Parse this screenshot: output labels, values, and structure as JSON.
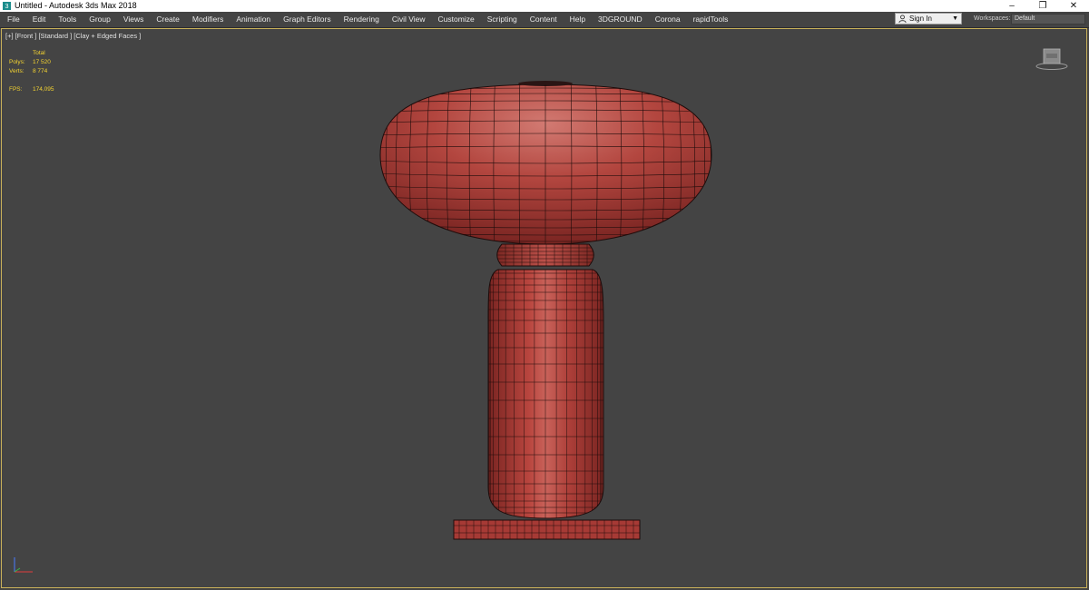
{
  "window": {
    "title": "Untitled - Autodesk 3ds Max 2018",
    "controls": [
      "–",
      "❐",
      "✕"
    ]
  },
  "menu": [
    "File",
    "Edit",
    "Tools",
    "Group",
    "Views",
    "Create",
    "Modifiers",
    "Animation",
    "Graph Editors",
    "Rendering",
    "Civil View",
    "Customize",
    "Scripting",
    "Content",
    "Help",
    "3DGROUND",
    "Corona",
    "rapidTools"
  ],
  "signin": {
    "label": "Sign In",
    "icon": "user-icon"
  },
  "workspaces": {
    "label": "Workspaces:",
    "value": "Default"
  },
  "viewport": {
    "label": "[+] [Front ] [Standard ] [Clay + Edged Faces ]",
    "stats": {
      "header": "Total",
      "polys_label": "Polys:",
      "polys": "17 520",
      "verts_label": "Verts:",
      "verts": "8 774",
      "fps_label": "FPS:",
      "fps": "174,095"
    },
    "border_color": "#c9b15a",
    "stats_color": "#f5d430",
    "clay_color": "#b0413e",
    "wire_color": "#1e0c0b"
  }
}
